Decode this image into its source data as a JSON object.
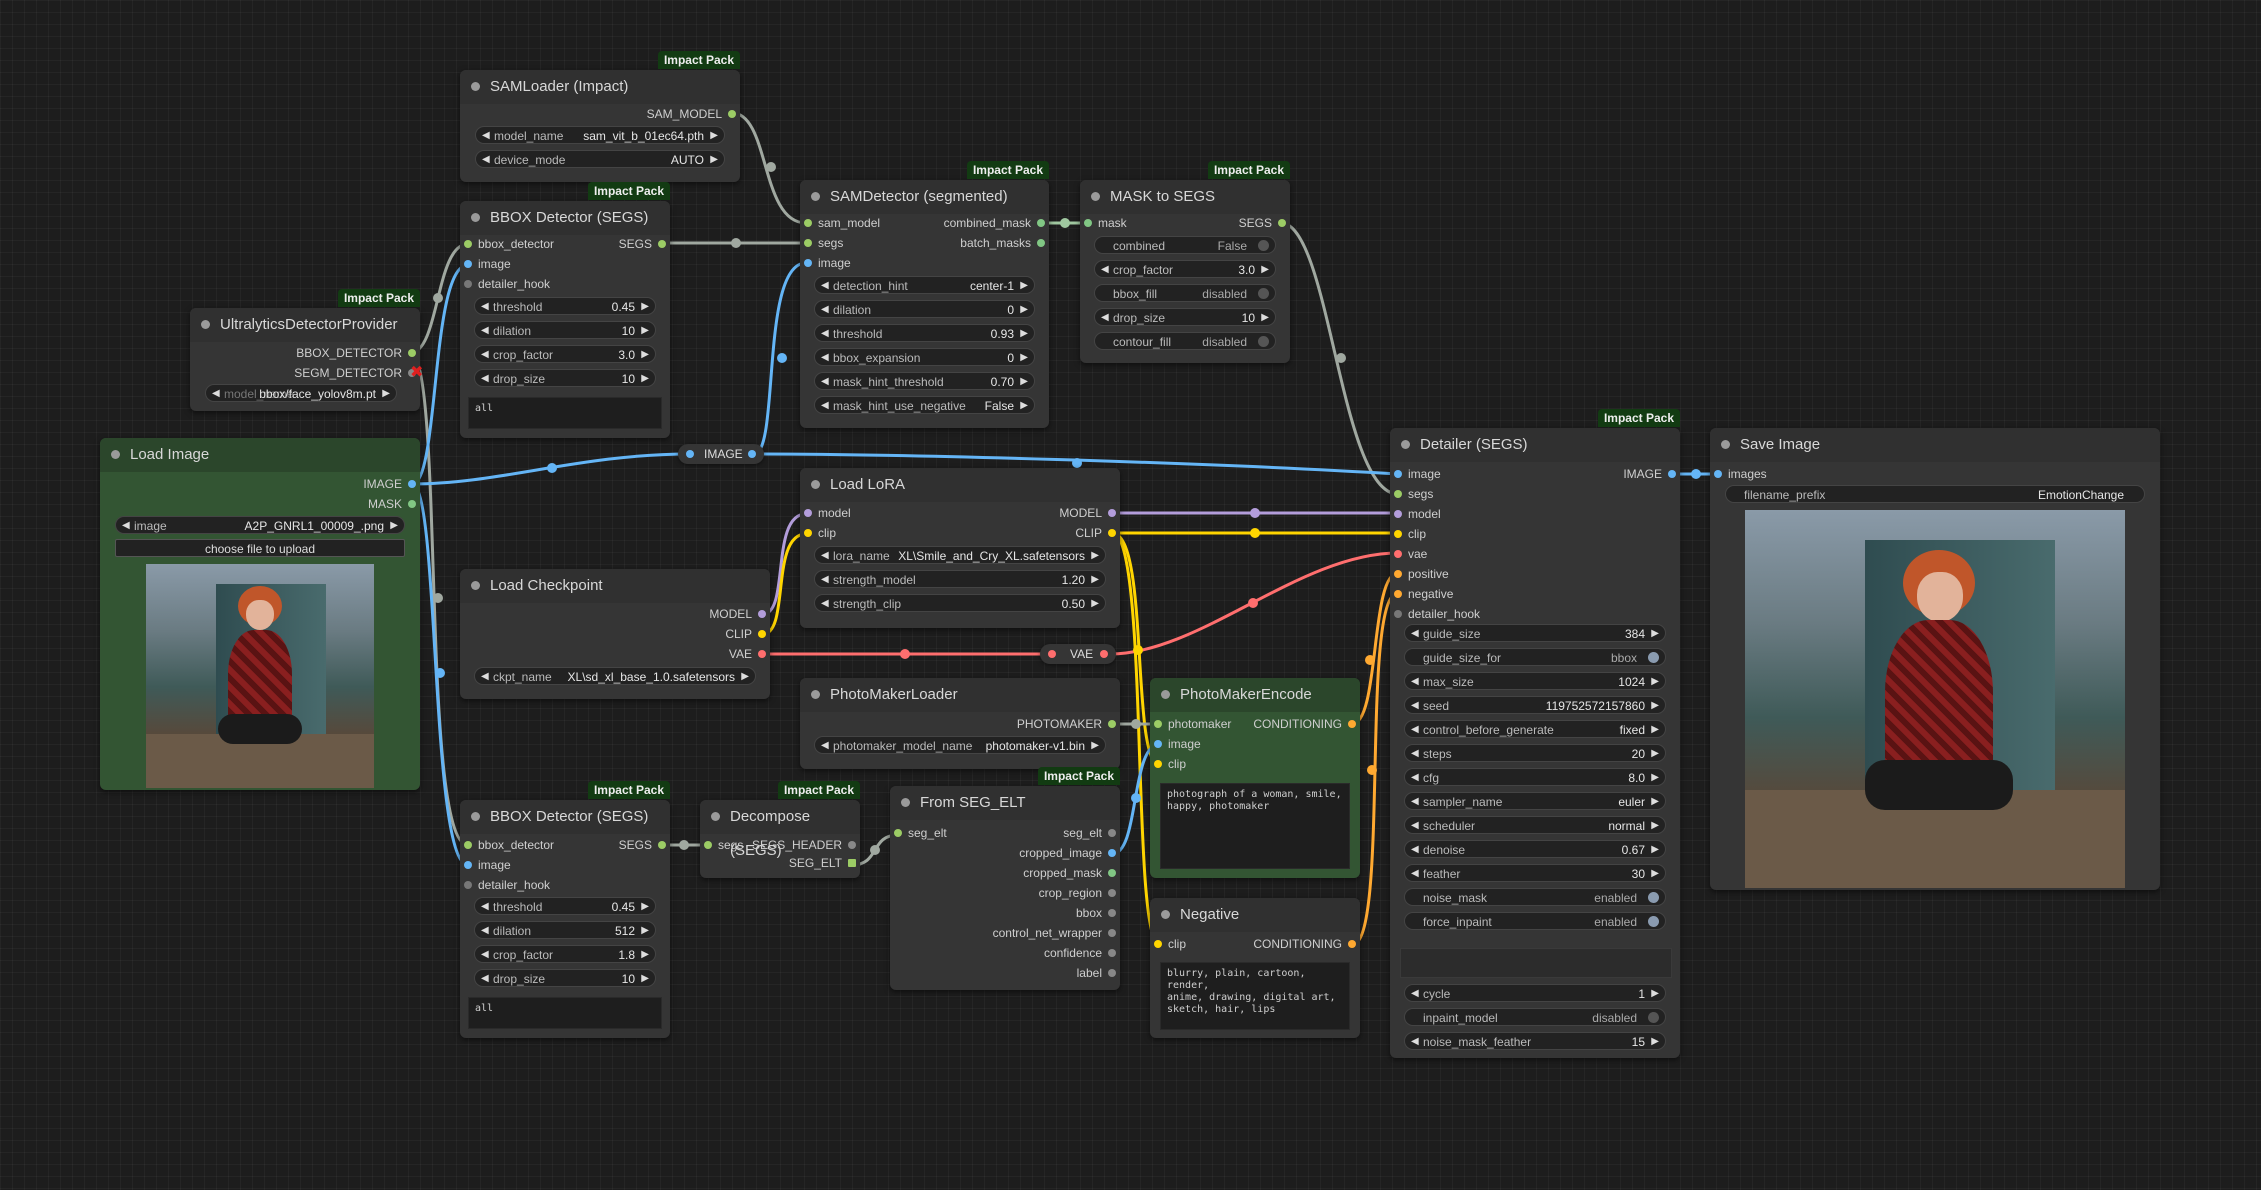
{
  "colors": {
    "image": "#64b5f6",
    "mask": "#81c784",
    "segs": "#9ccc65",
    "model": "#b39ddb",
    "clip": "#ffd500",
    "vae": "#ff6e6e",
    "conditioning": "#ffa931",
    "generic": "#a0a0a0",
    "badge": "#123b12"
  },
  "badge_text": "Impact Pack",
  "sam_loader": {
    "title": "SAMLoader (Impact)",
    "out_sam_model": "SAM_MODEL",
    "model_name_label": "model_name",
    "model_name_value": "sam_vit_b_01ec64.pth",
    "device_mode_label": "device_mode",
    "device_mode_value": "AUTO"
  },
  "bbox1": {
    "title": "BBOX Detector (SEGS)",
    "in_bbox_detector": "bbox_detector",
    "in_image": "image",
    "in_detailer_hook": "detailer_hook",
    "out_segs": "SEGS",
    "threshold_label": "threshold",
    "threshold": "0.45",
    "dilation_label": "dilation",
    "dilation": "10",
    "crop_factor_label": "crop_factor",
    "crop_factor": "3.0",
    "drop_size_label": "drop_size",
    "drop_size": "10",
    "labels_text": "all"
  },
  "ultralytics": {
    "title": "UltralyticsDetectorProvider",
    "out_bbox": "BBOX_DETECTOR",
    "out_segm": "SEGM_DETECTOR",
    "model_label": "model_name",
    "model_value": "bbox/face_yolov8m.pt"
  },
  "load_image": {
    "title": "Load Image",
    "out_image": "IMAGE",
    "out_mask": "MASK",
    "image_label": "image",
    "image_value": "A2P_GNRL1_00009_.png",
    "upload_button": "choose file to upload"
  },
  "sam_detector": {
    "title": "SAMDetector (segmented)",
    "in_sam_model": "sam_model",
    "in_segs": "segs",
    "in_image": "image",
    "out_combined_mask": "combined_mask",
    "out_batch_masks": "batch_masks",
    "detection_hint_label": "detection_hint",
    "detection_hint": "center-1",
    "dilation_label": "dilation",
    "dilation": "0",
    "threshold_label": "threshold",
    "threshold": "0.93",
    "bbox_expansion_label": "bbox_expansion",
    "bbox_expansion": "0",
    "mask_hint_threshold_label": "mask_hint_threshold",
    "mask_hint_threshold": "0.70",
    "mask_hint_use_negative_label": "mask_hint_use_negative",
    "mask_hint_use_negative": "False"
  },
  "mask_to_segs": {
    "title": "MASK to SEGS",
    "in_mask": "mask",
    "out_segs": "SEGS",
    "combined_label": "combined",
    "combined": "False",
    "crop_factor_label": "crop_factor",
    "crop_factor": "3.0",
    "bbox_fill_label": "bbox_fill",
    "bbox_fill": "disabled",
    "drop_size_label": "drop_size",
    "drop_size": "10",
    "contour_fill_label": "contour_fill",
    "contour_fill": "disabled"
  },
  "reroute_image": {
    "label": "IMAGE"
  },
  "reroute_vae": {
    "label": "VAE"
  },
  "load_lora": {
    "title": "Load LoRA",
    "in_model": "model",
    "in_clip": "clip",
    "out_model": "MODEL",
    "out_clip": "CLIP",
    "lora_name_label": "lora_name",
    "lora_name_value": "XL\\Smile_and_Cry_XL.safetensors",
    "strength_model_label": "strength_model",
    "strength_model": "1.20",
    "strength_clip_label": "strength_clip",
    "strength_clip": "0.50"
  },
  "load_checkpoint": {
    "title": "Load Checkpoint",
    "out_model": "MODEL",
    "out_clip": "CLIP",
    "out_vae": "VAE",
    "ckpt_label": "ckpt_name",
    "ckpt_value": "XL\\sd_xl_base_1.0.safetensors"
  },
  "photomaker_loader": {
    "title": "PhotoMakerLoader",
    "out_photomaker": "PHOTOMAKER",
    "model_label": "photomaker_model_name",
    "model_value": "photomaker-v1.bin"
  },
  "photomaker_encode": {
    "title": "PhotoMakerEncode",
    "in_photomaker": "photomaker",
    "in_image": "image",
    "in_clip": "clip",
    "out_conditioning": "CONDITIONING",
    "text": "photograph of a woman, smile,\nhappy, photomaker"
  },
  "negative": {
    "title": "Negative",
    "in_clip": "clip",
    "out_conditioning": "CONDITIONING",
    "text": "blurry, plain, cartoon, render,\nanime, drawing, digital art,\nsketch, hair, lips"
  },
  "bbox2": {
    "title": "BBOX Detector (SEGS)",
    "in_bbox_detector": "bbox_detector",
    "in_image": "image",
    "in_detailer_hook": "detailer_hook",
    "out_segs": "SEGS",
    "threshold_label": "threshold",
    "threshold": "0.45",
    "dilation_label": "dilation",
    "dilation": "512",
    "crop_factor_label": "crop_factor",
    "crop_factor": "1.8",
    "drop_size_label": "drop_size",
    "drop_size": "10",
    "labels_text": "all"
  },
  "decompose": {
    "title": "Decompose (SEGS)",
    "in_segs": "segs",
    "out_header": "SEGS_HEADER",
    "out_elt": "SEG_ELT"
  },
  "from_seg_elt": {
    "title": "From SEG_ELT",
    "in_seg_elt": "seg_elt",
    "outs": [
      "seg_elt",
      "cropped_image",
      "cropped_mask",
      "crop_region",
      "bbox",
      "control_net_wrapper",
      "confidence",
      "label"
    ]
  },
  "detailer": {
    "title": "Detailer (SEGS)",
    "ins": [
      "image",
      "segs",
      "model",
      "clip",
      "vae",
      "positive",
      "negative",
      "detailer_hook"
    ],
    "out_image": "IMAGE",
    "widgets": [
      {
        "label": "guide_size",
        "value": "384",
        "kind": "num"
      },
      {
        "label": "guide_size_for",
        "value": "bbox",
        "kind": "toggle_on"
      },
      {
        "label": "max_size",
        "value": "1024",
        "kind": "num"
      },
      {
        "label": "seed",
        "value": "119752572157860",
        "kind": "num"
      },
      {
        "label": "control_before_generate",
        "value": "fixed",
        "kind": "num"
      },
      {
        "label": "steps",
        "value": "20",
        "kind": "num"
      },
      {
        "label": "cfg",
        "value": "8.0",
        "kind": "num"
      },
      {
        "label": "sampler_name",
        "value": "euler",
        "kind": "num"
      },
      {
        "label": "scheduler",
        "value": "normal",
        "kind": "num"
      },
      {
        "label": "denoise",
        "value": "0.67",
        "kind": "num"
      },
      {
        "label": "feather",
        "value": "30",
        "kind": "num"
      },
      {
        "label": "noise_mask",
        "value": "enabled",
        "kind": "toggle_on"
      },
      {
        "label": "force_inpaint",
        "value": "enabled",
        "kind": "toggle_on"
      }
    ],
    "widgets2": [
      {
        "label": "cycle",
        "value": "1",
        "kind": "num"
      },
      {
        "label": "inpaint_model",
        "value": "disabled",
        "kind": "toggle_off"
      },
      {
        "label": "noise_mask_feather",
        "value": "15",
        "kind": "num"
      }
    ]
  },
  "save_image": {
    "title": "Save Image",
    "in_images": "images",
    "filename_label": "filename_prefix",
    "filename_value": "EmotionChange"
  }
}
